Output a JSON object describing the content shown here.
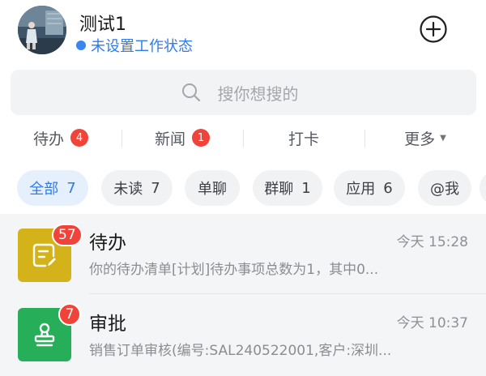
{
  "header": {
    "username": "测试1",
    "status_text": "未设置工作状态",
    "avatar_icon": "user-avatar",
    "add_icon": "plus-circle-icon",
    "accent_color": "#2f7be8"
  },
  "search": {
    "placeholder": "搜你想搜的",
    "icon": "search-icon"
  },
  "categories": [
    {
      "label": "待办",
      "badge": "4"
    },
    {
      "label": "新闻",
      "badge": "1"
    },
    {
      "label": "打卡"
    },
    {
      "label": "更多",
      "icon": "caret-down-icon"
    }
  ],
  "chips": [
    {
      "label": "全部",
      "count": "7",
      "active": true
    },
    {
      "label": "未读",
      "count": "7"
    },
    {
      "label": "单聊"
    },
    {
      "label": "群聊",
      "count": "1"
    },
    {
      "label": "应用",
      "count": "6"
    },
    {
      "label": "@我"
    }
  ],
  "messages": [
    {
      "title": "待办",
      "badge": "57",
      "time": "今天 15:28",
      "preview": "你的待办清单[计划]待办事项总数为1，其中0...",
      "icon": "todo-list-icon",
      "icon_color": "#d4b31a"
    },
    {
      "title": "审批",
      "badge": "7",
      "time": "今天 10:37",
      "preview": "销售订单审核(编号:SAL240522001,客户:深圳...",
      "icon": "stamp-icon",
      "icon_color": "#27ae58"
    }
  ]
}
